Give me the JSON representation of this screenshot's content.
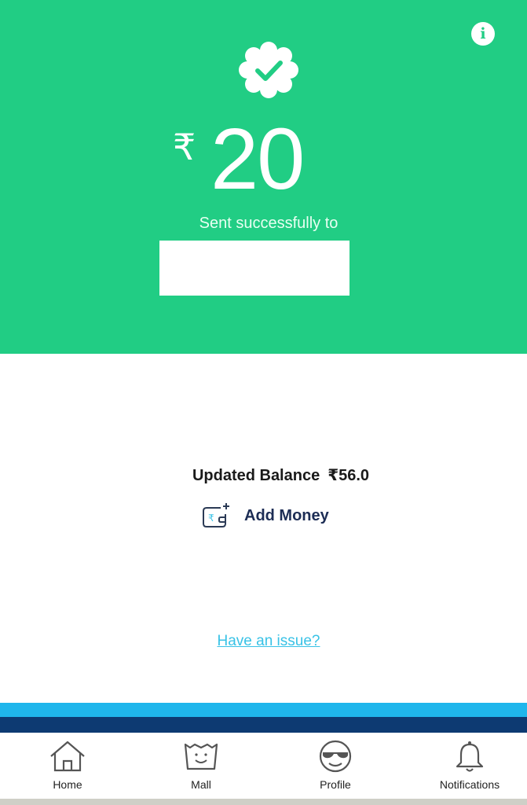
{
  "header": {
    "info_icon": "info-icon",
    "badge_icon": "verified-check-icon",
    "currency_symbol": "₹",
    "amount": "20",
    "status_text": "Sent successfully to"
  },
  "balance": {
    "label": "Updated Balance",
    "value": "₹56.0"
  },
  "actions": {
    "add_money_icon": "wallet-rupee-plus-icon",
    "add_money_label": "Add Money",
    "issue_link": "Have an issue?"
  },
  "nav": {
    "items": [
      {
        "label": "Home",
        "icon": "home-icon"
      },
      {
        "label": "Mall",
        "icon": "mall-bag-icon"
      },
      {
        "label": "Profile",
        "icon": "profile-face-icon"
      },
      {
        "label": "Notifications",
        "icon": "bell-icon"
      }
    ]
  },
  "colors": {
    "success_green": "#21cd84",
    "link_blue": "#38c2e6",
    "stripe_light": "#1fb6ec",
    "stripe_dark": "#0d3a72",
    "text_navy": "#1d2d55"
  }
}
